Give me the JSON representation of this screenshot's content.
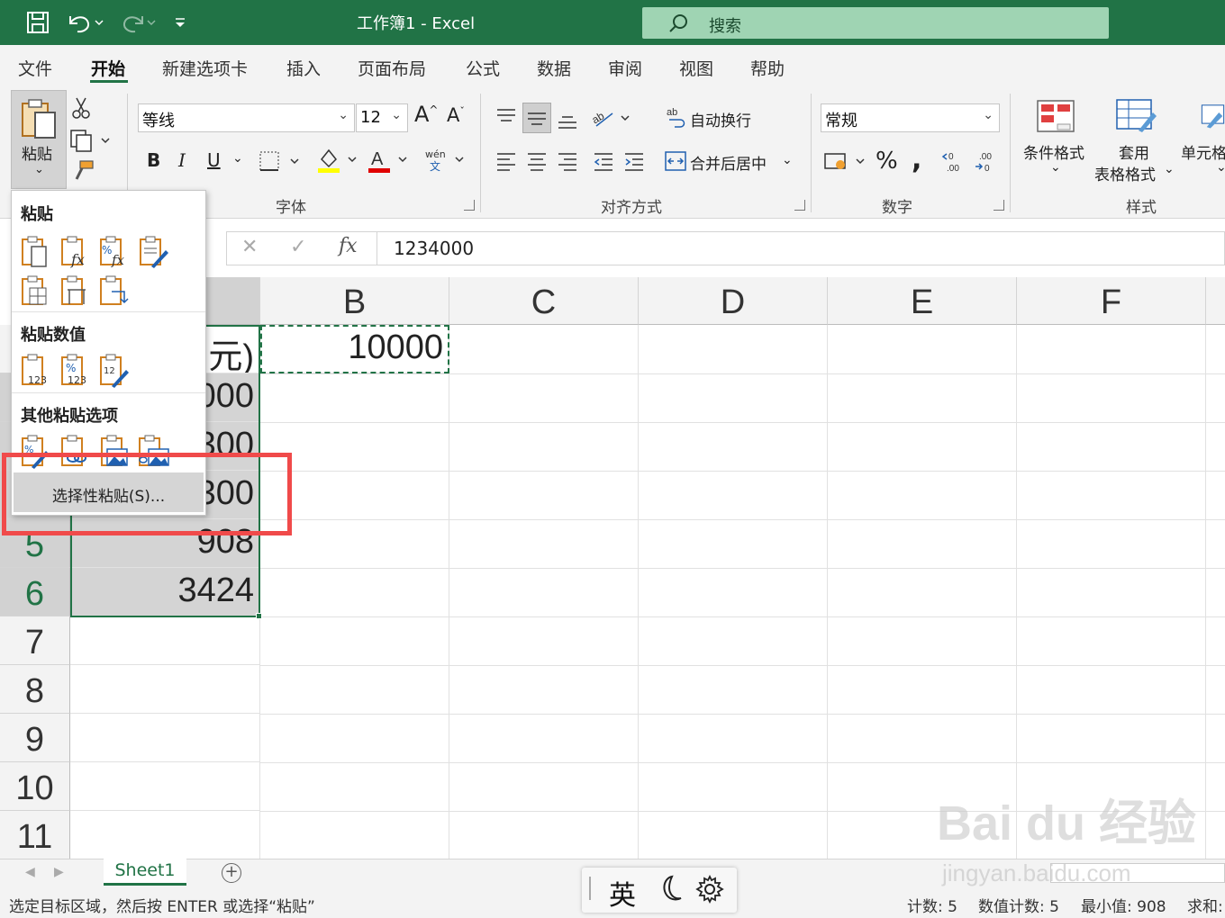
{
  "window": {
    "title": "工作簿1  -  Excel",
    "search_placeholder": "搜索"
  },
  "menu": {
    "tabs": [
      {
        "label": "文件"
      },
      {
        "label": "开始"
      },
      {
        "label": "新建选项卡"
      },
      {
        "label": "插入"
      },
      {
        "label": "页面布局"
      },
      {
        "label": "公式"
      },
      {
        "label": "数据"
      },
      {
        "label": "审阅"
      },
      {
        "label": "视图"
      },
      {
        "label": "帮助"
      }
    ],
    "active": "开始"
  },
  "ribbon": {
    "paste_label": "粘贴",
    "font_name": "等线",
    "font_size": "12",
    "wrap_text": "自动换行",
    "merge_center": "合并后居中",
    "number_format": "常规",
    "conditional_format": "条件格式",
    "format_table_1": "套用",
    "format_table_2": "表格格式",
    "cell_styles": "单元格",
    "group_font": "字体",
    "group_align": "对齐方式",
    "group_number": "数字",
    "group_styles": "样式",
    "bold": "B",
    "italic": "I",
    "underline": "U"
  },
  "formula_bar": {
    "value": "1234000"
  },
  "grid": {
    "columns": [
      "B",
      "C",
      "D",
      "E",
      "F"
    ],
    "rows": [
      "5",
      "6",
      "7",
      "8",
      "9",
      "10",
      "11"
    ],
    "cells": {
      "a1_partial": "元)",
      "a2_partial": "000",
      "a3_partial": "300",
      "a4_partial": "300",
      "a5": "908",
      "a6": "3424",
      "b1": "10000"
    }
  },
  "paste_menu": {
    "heading_paste": "粘贴",
    "heading_values": "粘贴数值",
    "heading_other": "其他粘贴选项",
    "special": "选择性粘贴(S)..."
  },
  "sheets": {
    "tabs": [
      "Sheet1"
    ]
  },
  "ime": {
    "lang": "英"
  },
  "status": {
    "message": "选定目标区域，然后按 ENTER 或选择“粘贴”",
    "count": "计数: 5",
    "numeric_count": "数值计数: 5",
    "min": "最小值: 908",
    "sum": "求和:"
  },
  "watermark": {
    "brand": "Bai du 经验",
    "url": "jingyan.baidu.com"
  },
  "colors": {
    "excel_green": "#217346",
    "highlight_red": "#f04a4a"
  }
}
